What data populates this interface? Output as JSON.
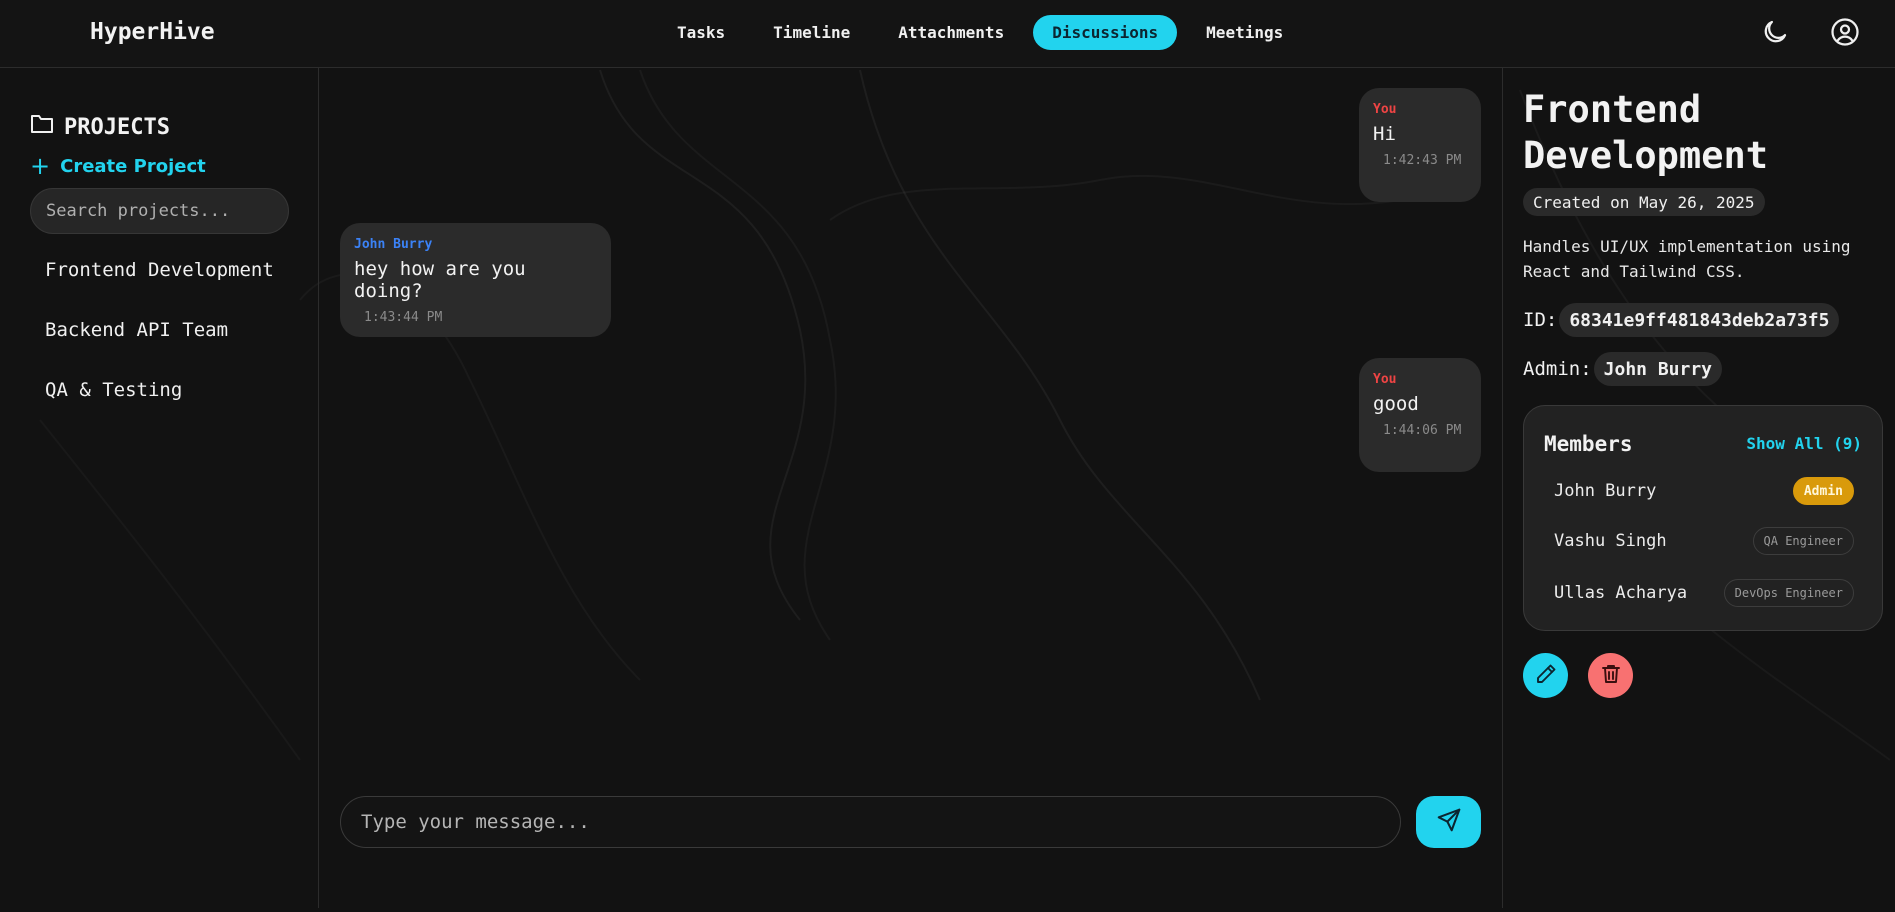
{
  "header": {
    "brand": "HyperHive",
    "tabs": [
      {
        "label": "Tasks",
        "active": false
      },
      {
        "label": "Timeline",
        "active": false
      },
      {
        "label": "Attachments",
        "active": false
      },
      {
        "label": "Discussions",
        "active": true
      },
      {
        "label": "Meetings",
        "active": false
      }
    ],
    "icons": [
      "moon-icon",
      "user-circle-icon"
    ]
  },
  "sidebar": {
    "heading": "PROJECTS",
    "heading_icon": "folder-icon",
    "create_label": "Create Project",
    "search_placeholder": "Search projects...",
    "projects": [
      "Frontend Development",
      "Backend API Team",
      "QA & Testing"
    ]
  },
  "chat": {
    "messages": [
      {
        "sender": "You",
        "text": "Hi",
        "time": "1:42:43 PM",
        "mine": true
      },
      {
        "sender": "John Burry",
        "text": "hey how are you doing?",
        "time": "1:43:44 PM",
        "mine": false
      },
      {
        "sender": "You",
        "text": "good",
        "time": "1:44:06 PM",
        "mine": true
      }
    ],
    "composer_placeholder": "Type your message...",
    "send_icon": "send-icon"
  },
  "details": {
    "title": "Frontend Development",
    "created": "Created on May 26, 2025",
    "description": "Handles UI/UX implementation using React and Tailwind CSS.",
    "id_label": "ID:",
    "id_value": "68341e9ff481843deb2a73f5",
    "admin_label": "Admin:",
    "admin_value": "John Burry",
    "members_title": "Members",
    "show_all": "Show All (9)",
    "members": [
      {
        "name": "John Burry",
        "role": "Admin"
      },
      {
        "name": "Vashu Singh",
        "role": "QA Engineer"
      },
      {
        "name": "Ullas Acharya",
        "role": "DevOps Engineer"
      }
    ],
    "actions": [
      "edit-icon",
      "trash-icon"
    ]
  },
  "colors": {
    "accent": "#22d3ee",
    "background": "#121212",
    "danger": "#f87171",
    "admin_badge": "#d99a0b",
    "my_sender": "#ef4444",
    "other_sender": "#3b82f6"
  }
}
